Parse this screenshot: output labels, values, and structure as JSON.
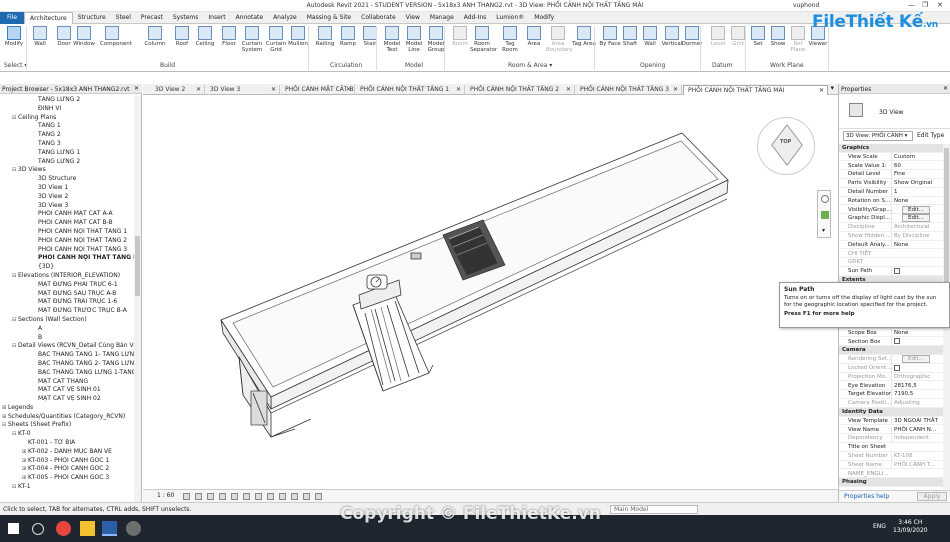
{
  "window": {
    "title": "Autodesk Revit 2021 - STUDENT VERSION - 5x18x3 ANH THANG2.rvt - 3D View: PHỐI CẢNH NỘI THẤT TẦNG MÁI",
    "user": "vuphond",
    "controls": [
      "—",
      "❐",
      "✕"
    ]
  },
  "ribbon_tabs": [
    "File",
    "Architecture",
    "Structure",
    "Steel",
    "Precast",
    "Systems",
    "Insert",
    "Annotate",
    "Analyze",
    "Massing & Site",
    "Collaborate",
    "View",
    "Manage",
    "Add-Ins",
    "Lumion®",
    "Modify"
  ],
  "ribbon": {
    "buttons": [
      {
        "label": "Modify",
        "icon": "cursor-icon"
      },
      {
        "label": "Wall",
        "icon": "wall-icon"
      },
      {
        "label": "Door",
        "icon": "door-icon"
      },
      {
        "label": "Window",
        "icon": "window-icon"
      },
      {
        "label": "Component",
        "icon": "component-icon"
      },
      {
        "label": "Column",
        "icon": "column-icon"
      },
      {
        "label": "Roof",
        "icon": "roof-icon"
      },
      {
        "label": "Ceiling",
        "icon": "ceiling-icon"
      },
      {
        "label": "Floor",
        "icon": "floor-icon"
      },
      {
        "label": "Curtain System",
        "icon": "curtain-system-icon"
      },
      {
        "label": "Curtain Grid",
        "icon": "curtain-grid-icon"
      },
      {
        "label": "Mullion",
        "icon": "mullion-icon"
      },
      {
        "label": "Railing",
        "icon": "railing-icon"
      },
      {
        "label": "Ramp",
        "icon": "ramp-icon"
      },
      {
        "label": "Stair",
        "icon": "stair-icon"
      },
      {
        "label": "Model Text",
        "icon": "model-text-icon"
      },
      {
        "label": "Model Line",
        "icon": "model-line-icon"
      },
      {
        "label": "Model Group",
        "icon": "model-group-icon"
      },
      {
        "label": "Room",
        "icon": "room-icon",
        "dim": true
      },
      {
        "label": "Room Separator",
        "icon": "room-separator-icon"
      },
      {
        "label": "Tag Room",
        "icon": "tag-room-icon"
      },
      {
        "label": "Area",
        "icon": "area-icon"
      },
      {
        "label": "Area Boundary",
        "icon": "area-boundary-icon",
        "dim": true
      },
      {
        "label": "Tag Area",
        "icon": "tag-area-icon"
      },
      {
        "label": "By Face",
        "icon": "by-face-icon"
      },
      {
        "label": "Shaft",
        "icon": "shaft-icon"
      },
      {
        "label": "Wall",
        "icon": "opening-wall-icon"
      },
      {
        "label": "Vertical",
        "icon": "vertical-icon"
      },
      {
        "label": "Dormer",
        "icon": "dormer-icon"
      },
      {
        "label": "Level",
        "icon": "level-icon",
        "dim": true
      },
      {
        "label": "Grid",
        "icon": "grid-icon",
        "dim": true
      },
      {
        "label": "Set",
        "icon": "set-icon"
      },
      {
        "label": "Show",
        "icon": "show-icon"
      },
      {
        "label": "Ref Plane",
        "icon": "ref-plane-icon",
        "dim": true
      },
      {
        "label": "Viewer",
        "icon": "viewer-icon"
      }
    ],
    "panels": [
      "Select ▾",
      "Build",
      "Circulation",
      "Model",
      "Room & Area ▾",
      "Opening",
      "Datum",
      "Work Plane"
    ]
  },
  "project_browser": {
    "title": "Project Browser - 5x18x3 ANH THANG2.rvt",
    "close": "✕",
    "items": [
      {
        "label": "TẦNG LỬNG 2",
        "level": 3
      },
      {
        "label": "ĐỈNH VỈ",
        "level": 3
      },
      {
        "label": "Ceiling Plans",
        "level": 1,
        "ex": "⊟"
      },
      {
        "label": "TẦNG 1",
        "level": 3
      },
      {
        "label": "TẦNG 2",
        "level": 3
      },
      {
        "label": "TẦNG 3",
        "level": 3
      },
      {
        "label": "TẦNG LỬNG 1",
        "level": 3
      },
      {
        "label": "TẦNG LỬNG 2",
        "level": 3
      },
      {
        "label": "3D Views",
        "level": 1,
        "ex": "⊟"
      },
      {
        "label": "3D Structure",
        "level": 3
      },
      {
        "label": "3D View 1",
        "level": 3
      },
      {
        "label": "3D View 2",
        "level": 3
      },
      {
        "label": "3D View 3",
        "level": 3
      },
      {
        "label": "PHỐI CẢNH MẶT CẮT A-A",
        "level": 3
      },
      {
        "label": "PHỐI CẢNH MẶT CẮT B-B",
        "level": 3
      },
      {
        "label": "PHỐI CẢNH NỘI THẤT TẦNG 1",
        "level": 3
      },
      {
        "label": "PHỐI CẢNH NỘI THẤT TẦNG 2",
        "level": 3
      },
      {
        "label": "PHỐI CẢNH NỘI THẤT TẦNG 3",
        "level": 3
      },
      {
        "label": "PHỐI CẢNH NỘI THẤT TẦNG MÁI",
        "level": 3,
        "bold": true
      },
      {
        "label": "{3D}",
        "level": 3
      },
      {
        "label": "Elevations (INTERIOR_ELEVATION)",
        "level": 1,
        "ex": "⊟"
      },
      {
        "label": "MẶT ĐỨNG PHẢI TRỤC 6-1",
        "level": 3
      },
      {
        "label": "MẶT ĐỨNG SAU TRỤC A-B",
        "level": 3
      },
      {
        "label": "MẶT ĐỨNG TRÁI TRỤC 1-6",
        "level": 3
      },
      {
        "label": "MẶT ĐỨNG TRƯỚC TRỤC B-A",
        "level": 3
      },
      {
        "label": "Sections (Wall Section)",
        "level": 1,
        "ex": "⊟"
      },
      {
        "label": "A",
        "level": 3
      },
      {
        "label": "B",
        "level": 3
      },
      {
        "label": "Detail Views (RCVN_Detail Cùng Bản Vẽ)",
        "level": 1,
        "ex": "⊟"
      },
      {
        "label": "BẬC THANG TẦNG 1- TẦNG LỬNG 1",
        "level": 3
      },
      {
        "label": "BẬC THANG TẦNG 2- TẦNG LỬNG 2",
        "level": 3
      },
      {
        "label": "BẬC THANG TẦNG LỬNG 1-TẦNG 2",
        "level": 3
      },
      {
        "label": "MẶT CẮT THANG",
        "level": 3
      },
      {
        "label": "MẶT CẮT VỆ SINH 01",
        "level": 3
      },
      {
        "label": "MẶT CẮT VỆ SINH 02",
        "level": 3
      },
      {
        "label": "Legends",
        "level": 0,
        "ex": "⊞"
      },
      {
        "label": "Schedules/Quantities (Category_RCVN)",
        "level": 0,
        "ex": "⊞"
      },
      {
        "label": "Sheets (Sheet Prefix)",
        "level": 0,
        "ex": "⊟"
      },
      {
        "label": "KT-0",
        "level": 1,
        "ex": "⊟"
      },
      {
        "label": "KT-001 - TỜ BÌA",
        "level": 2
      },
      {
        "label": "KT-002 - DANH MỤC BẢN VẼ",
        "level": 2,
        "ex": "⊞"
      },
      {
        "label": "KT-003 - PHỐI CẢNH GÓC 1",
        "level": 2,
        "ex": "⊞"
      },
      {
        "label": "KT-004 - PHỐI CẢNH GÓC 2",
        "level": 2,
        "ex": "⊞"
      },
      {
        "label": "KT-005 - PHỐI CẢNH GÓC 3",
        "level": 2,
        "ex": "⊞"
      },
      {
        "label": "KT-1",
        "level": 1,
        "ex": "⊟"
      }
    ]
  },
  "view_tabs": [
    {
      "label": "3D View 2"
    },
    {
      "label": "3D View 3"
    },
    {
      "label": "PHỐI CẢNH MẶT CẮT B-B"
    },
    {
      "label": "PHỐI CẢNH NỘI THẤT TẦNG 1"
    },
    {
      "label": "PHỐI CẢNH NỘI THẤT TẦNG 2"
    },
    {
      "label": "PHỐI CẢNH NỘI THẤT TẦNG 3"
    },
    {
      "label": "PHỐI CẢNH NỘI THẤT TẦNG MÁI",
      "active": true
    }
  ],
  "viewcube_label": "TOP",
  "view_control": {
    "scale": "1 : 60"
  },
  "properties": {
    "title": "Properties",
    "close": "✕",
    "type_name": "3D View",
    "selector": "3D View: PHỐI CẢNH ▾",
    "edit_type": "Edit Type",
    "rows": [
      {
        "group": "Graphics"
      },
      {
        "k": "View Scale",
        "v": "Custom"
      },
      {
        "k": "Scale Value    1:",
        "v": "60"
      },
      {
        "k": "Detail Level",
        "v": "Fine"
      },
      {
        "k": "Parts Visibility",
        "v": "Show Original"
      },
      {
        "k": "Detail Number",
        "v": "1"
      },
      {
        "k": "Rotation on S...",
        "v": "None"
      },
      {
        "k": "Visibility/Grap...",
        "btn": "Edit..."
      },
      {
        "k": "Graphic Displ...",
        "btn": "Edit..."
      },
      {
        "k": "Discipline",
        "v": "Architectural",
        "dim": true
      },
      {
        "k": "Show Hidden ...",
        "v": "By Discipline",
        "dim": true
      },
      {
        "k": "Default Analy...",
        "v": "None"
      },
      {
        "k": "CHI TIẾT",
        "v": "",
        "dim": true
      },
      {
        "k": "GĐKT",
        "v": "",
        "dim": true
      },
      {
        "k": "Sun Path",
        "chk": true
      },
      {
        "group": "Extents"
      },
      {
        "k": "",
        "v": ""
      },
      {
        "k": "",
        "v": ""
      },
      {
        "k": "",
        "v": ""
      },
      {
        "k": "",
        "v": ""
      },
      {
        "k": "",
        "v": ""
      },
      {
        "k": "Scope Box",
        "v": "None"
      },
      {
        "k": "Section Box",
        "chk": true
      },
      {
        "group": "Camera"
      },
      {
        "k": "Rendering Set...",
        "btn": "Edit...",
        "dim": true
      },
      {
        "k": "Locked Orient...",
        "chk": true,
        "dim": true
      },
      {
        "k": "Projection Mo...",
        "v": "Orthographic",
        "dim": true
      },
      {
        "k": "Eye Elevation",
        "v": "28176,5"
      },
      {
        "k": "Target Elevation",
        "v": "7190,5"
      },
      {
        "k": "Camera Positi...",
        "v": "Adjusting",
        "dim": true
      },
      {
        "group": "Identity Data"
      },
      {
        "k": "View Template",
        "v": "3D NGOẠI THẤT"
      },
      {
        "k": "View Name",
        "v": "PHỐI CẢNH N..."
      },
      {
        "k": "Dependency",
        "v": "Independent",
        "dim": true
      },
      {
        "k": "Title on Sheet",
        "v": ""
      },
      {
        "k": "Sheet Number",
        "v": "KT-108",
        "dim": true
      },
      {
        "k": "Sheet Name",
        "v": "PHỐI CẢNH T...",
        "dim": true
      },
      {
        "k": "NAME_ENGLI...",
        "v": "",
        "dim": true
      },
      {
        "group": "Phasing"
      }
    ],
    "help_link": "Properties help",
    "apply": "Apply"
  },
  "tooltip": {
    "title": "Sun Path",
    "body": "Turns on or turns off the display of light cast by the sun for the geographic location specified for the project.",
    "f1": "Press F1 for more help"
  },
  "status": {
    "message": "Click to select, TAB for alternates, CTRL adds, SHIFT unselects.",
    "model": "Main Model"
  },
  "taskbar": {
    "time": "3:46 CH",
    "date": "13/09/2020",
    "lang": "ENG"
  },
  "brand": {
    "logo_main": "File",
    "logo_rest": "Thiết Kế",
    "logo_tld": ".vn"
  },
  "watermark": "Copyright © FileThietKe.vn"
}
